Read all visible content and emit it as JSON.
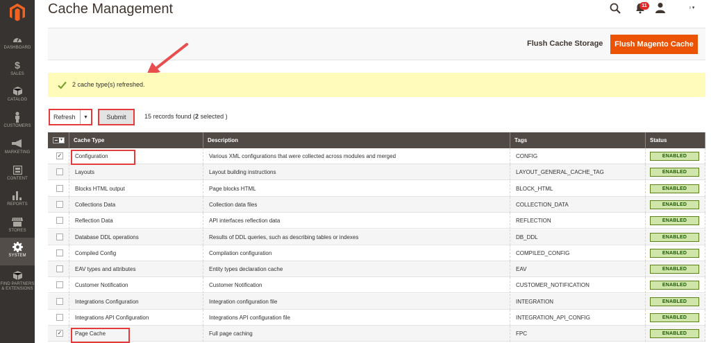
{
  "header": {
    "title": "Cache Management",
    "notification_count": "11",
    "username": "ı ▾"
  },
  "sidebar": {
    "items": [
      {
        "label": "DASHBOARD",
        "icon": "dashboard-icon"
      },
      {
        "label": "SALES",
        "icon": "dollar-icon"
      },
      {
        "label": "CATALOG",
        "icon": "cube-icon"
      },
      {
        "label": "CUSTOMERS",
        "icon": "person-icon"
      },
      {
        "label": "MARKETING",
        "icon": "megaphone-icon"
      },
      {
        "label": "CONTENT",
        "icon": "layout-icon"
      },
      {
        "label": "REPORTS",
        "icon": "bar-chart-icon"
      },
      {
        "label": "STORES",
        "icon": "store-icon"
      },
      {
        "label": "SYSTEM",
        "icon": "gear-icon"
      },
      {
        "label": "FIND PARTNERS & EXTENSIONS",
        "icon": "box-icon"
      }
    ],
    "active": "SYSTEM"
  },
  "actions": {
    "flush_storage": "Flush Cache Storage",
    "flush_magento": "Flush Magento Cache"
  },
  "message": {
    "text": "2 cache type(s) refreshed."
  },
  "toolbar": {
    "mass_action_value": "Refresh",
    "submit_label": "Submit",
    "records_prefix": "15 records found (",
    "records_selected": "2",
    "records_suffix": " selected )"
  },
  "grid": {
    "columns": [
      "Cache Type",
      "Description",
      "Tags",
      "Status"
    ],
    "rows": [
      {
        "type": "Configuration",
        "description": "Various XML configurations that were collected across modules and merged",
        "tags": "CONFIG",
        "status": "ENABLED",
        "checked": "✓"
      },
      {
        "type": "Layouts",
        "description": "Layout building instructions",
        "tags": "LAYOUT_GENERAL_CACHE_TAG",
        "status": "ENABLED",
        "checked": ""
      },
      {
        "type": "Blocks HTML output",
        "description": "Page blocks HTML",
        "tags": "BLOCK_HTML",
        "status": "ENABLED",
        "checked": ""
      },
      {
        "type": "Collections Data",
        "description": "Collection data files",
        "tags": "COLLECTION_DATA",
        "status": "ENABLED",
        "checked": ""
      },
      {
        "type": "Reflection Data",
        "description": "API interfaces reflection data",
        "tags": "REFLECTION",
        "status": "ENABLED",
        "checked": ""
      },
      {
        "type": "Database DDL operations",
        "description": "Results of DDL queries, such as describing tables or indexes",
        "tags": "DB_DDL",
        "status": "ENABLED",
        "checked": ""
      },
      {
        "type": "Compiled Config",
        "description": "Compilation configuration",
        "tags": "COMPILED_CONFIG",
        "status": "ENABLED",
        "checked": ""
      },
      {
        "type": "EAV types and attributes",
        "description": "Entity types declaration cache",
        "tags": "EAV",
        "status": "ENABLED",
        "checked": ""
      },
      {
        "type": "Customer Notification",
        "description": "Customer Notification",
        "tags": "CUSTOMER_NOTIFICATION",
        "status": "ENABLED",
        "checked": ""
      },
      {
        "type": "Integrations Configuration",
        "description": "Integration configuration file",
        "tags": "INTEGRATION",
        "status": "ENABLED",
        "checked": ""
      },
      {
        "type": "Integrations API Configuration",
        "description": "Integrations API configuration file",
        "tags": "INTEGRATION_API_CONFIG",
        "status": "ENABLED",
        "checked": ""
      },
      {
        "type": "Page Cache",
        "description": "Full page caching",
        "tags": "FPC",
        "status": "ENABLED",
        "checked": "✓"
      }
    ]
  },
  "colors": {
    "sidebar_bg": "#373330",
    "accent": "#eb5202",
    "message_bg": "#fffbbb",
    "grid_header": "#514943",
    "enabled_bg": "#d0e5a9",
    "highlight": "#e33b3b"
  }
}
